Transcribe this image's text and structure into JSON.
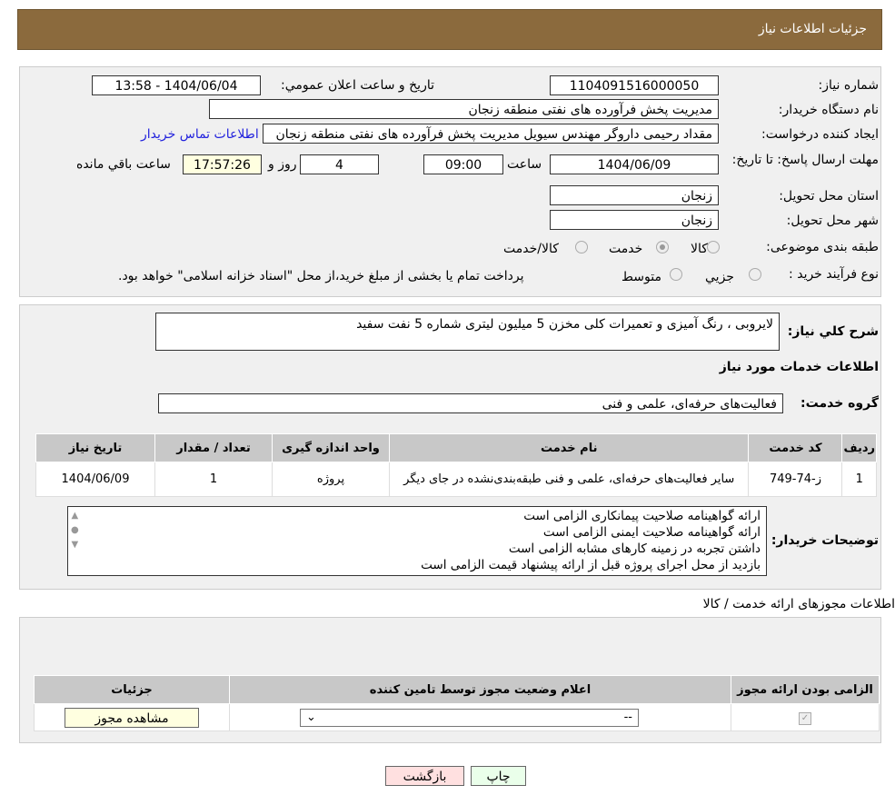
{
  "header": {
    "title": "جزئیات اطلاعات نیاز"
  },
  "form": {
    "need_number_label": "شماره نیاز:",
    "need_number": "1104091516000050",
    "announce_label": "تاریخ و ساعت اعلان عمومي:",
    "announce_value": "1404/06/04 - 13:58",
    "buyer_label": "نام دستگاه خریدار:",
    "buyer_value": "مدیریت پخش فرآورده های نفتی منطقه زنجان",
    "creator_label": "ایجاد کننده درخواست:",
    "creator_value": "مقداد رحیمی داروگر مهندس سیویل مدیریت پخش فرآورده های نفتی منطقه زنجان",
    "contact_link": "اطلاعات تماس خریدار",
    "deadline_label": "مهلت ارسال پاسخ: تا تاریخ:",
    "deadline_date": "1404/06/09",
    "time_label": "ساعت",
    "deadline_time": "09:00",
    "days": "4",
    "days_label": "روز و",
    "remaining": "17:57:26",
    "remaining_label": "ساعت باقي مانده",
    "province_label": "استان محل تحویل:",
    "province": "زنجان",
    "city_label": "شهر محل تحویل:",
    "city": "زنجان",
    "category_label": "طبقه بندی موضوعی:",
    "category_options": [
      "کالا",
      "خدمت",
      "کالا/خدمت"
    ],
    "process_label": "نوع فرآیند خرید :",
    "process_options": [
      "جزيي",
      "متوسط"
    ],
    "process_note": "پرداخت تمام یا بخشی از مبلغ خرید،از محل \"اسناد خزانه اسلامی\" خواهد بود.",
    "description_label": "شرح کلي نیاز:",
    "description": "لایروبی ، رنگ آمیزی و تعمیرات کلی مخزن 5 میلیون لیتری  شماره 5 نفت سفید",
    "services_title": "اطلاعات خدمات مورد نیاز",
    "service_group_label": "گروه خدمت:",
    "service_group": "فعالیت‌های حرفه‌ای، علمی و فنی"
  },
  "table": {
    "headers": [
      "ردیف",
      "کد خدمت",
      "نام خدمت",
      "واحد اندازه گیری",
      "تعداد / مقدار",
      "تاریخ نیاز"
    ],
    "rows": [
      [
        "1",
        "ز-74-749",
        "سایر فعالیت‌های حرفه‌ای، علمی و فنی طبقه‌بندی‌نشده در جای دیگر",
        "پروژه",
        "1",
        "1404/06/09"
      ]
    ]
  },
  "buyer_notes_label": "توضیحات خریدار:",
  "buyer_notes": [
    "ارائه گواهینامه صلاحیت پیمانکاری الزامی است",
    "ارائه گواهینامه صلاحیت ایمنی الزامی است",
    "داشتن تجربه در زمینه کارهای مشابه الزامی است",
    "بازدید از محل اجرای پروژه قبل از ارائه پیشنهاد قیمت الزامی است"
  ],
  "permits": {
    "title": "اطلاعات مجوزهای ارائه خدمت / کالا",
    "headers": [
      "الزامی بودن ارائه مجوز",
      "اعلام وضعیت مجوز توسط تامین کننده",
      "جزئیات"
    ],
    "select_value": "--",
    "view_button": "مشاهده مجوز"
  },
  "buttons": {
    "print": "چاپ",
    "back": "بازگشت"
  }
}
